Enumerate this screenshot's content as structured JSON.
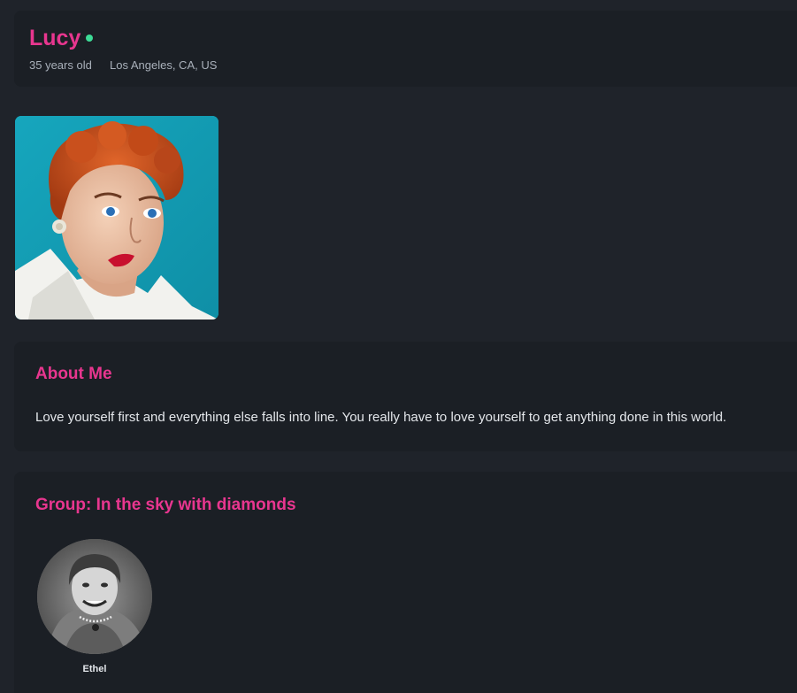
{
  "profile": {
    "name": "Lucy",
    "age": "35 years old",
    "location": "Los Angeles, CA, US",
    "status_color": "#3ddc97"
  },
  "about": {
    "title": "About Me",
    "text": "Love yourself first and everything else falls into line. You really have to love yourself to get anything done in this world."
  },
  "group": {
    "title": "Group: In the sky with diamonds",
    "members": [
      {
        "name": "Ethel"
      }
    ]
  },
  "colors": {
    "accent": "#e8368f",
    "background": "#1f232a",
    "card": "#1b1f25",
    "online": "#3ddc97"
  }
}
